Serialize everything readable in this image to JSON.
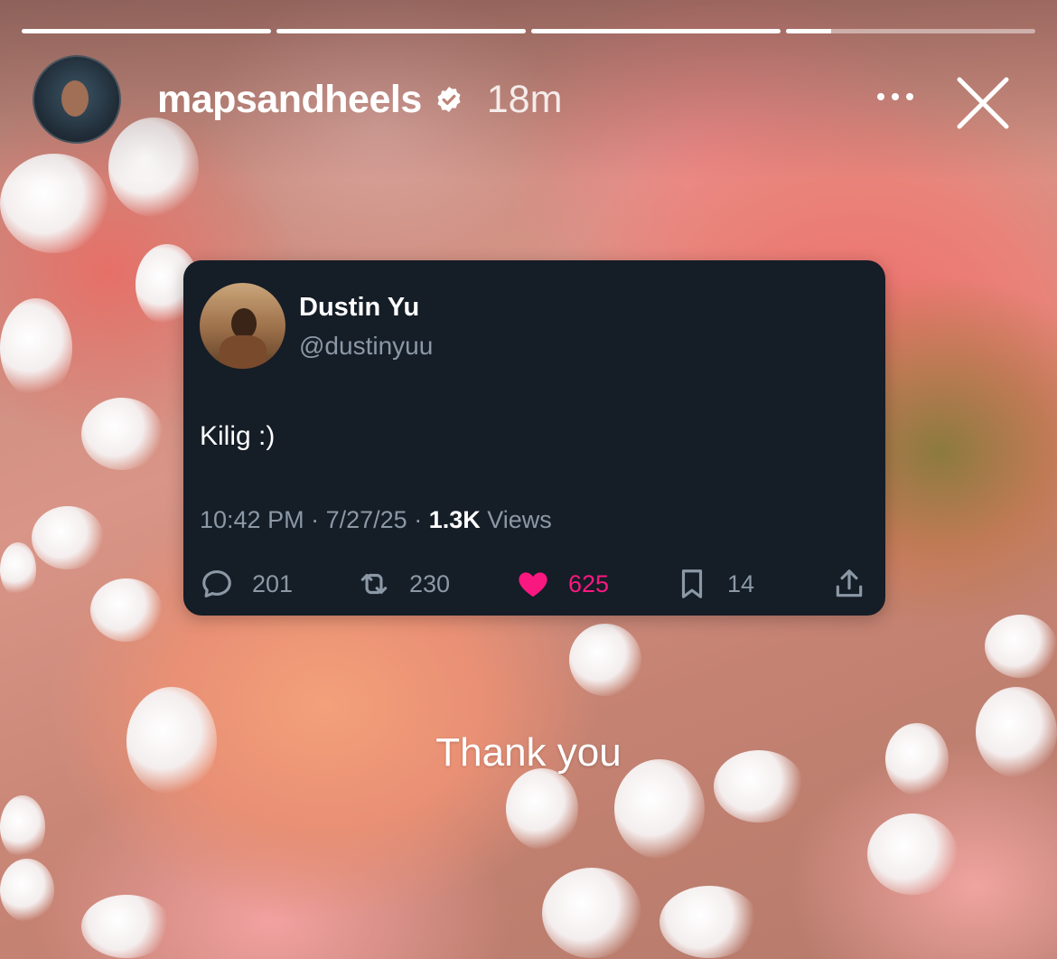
{
  "story": {
    "progress": [
      1,
      1,
      1,
      0.18
    ],
    "username": "mapsandheels",
    "verified": true,
    "time": "18m",
    "caption": "Thank you"
  },
  "tweet": {
    "name": "Dustin Yu",
    "handle": "@dustinyuu",
    "text": "Kilig :)",
    "time": "10:42 PM",
    "date": "7/27/25",
    "views_count": "1.3K",
    "views_label": "Views",
    "replies": "201",
    "retweets": "230",
    "likes": "625",
    "bookmarks": "14"
  },
  "colors": {
    "like": "#f91880",
    "card_bg": "#151d27",
    "muted": "#8b98a5"
  },
  "icons": [
    "verified-badge-icon",
    "more-icon",
    "close-icon",
    "reply-icon",
    "retweet-icon",
    "heart-icon",
    "bookmark-icon",
    "share-icon"
  ]
}
